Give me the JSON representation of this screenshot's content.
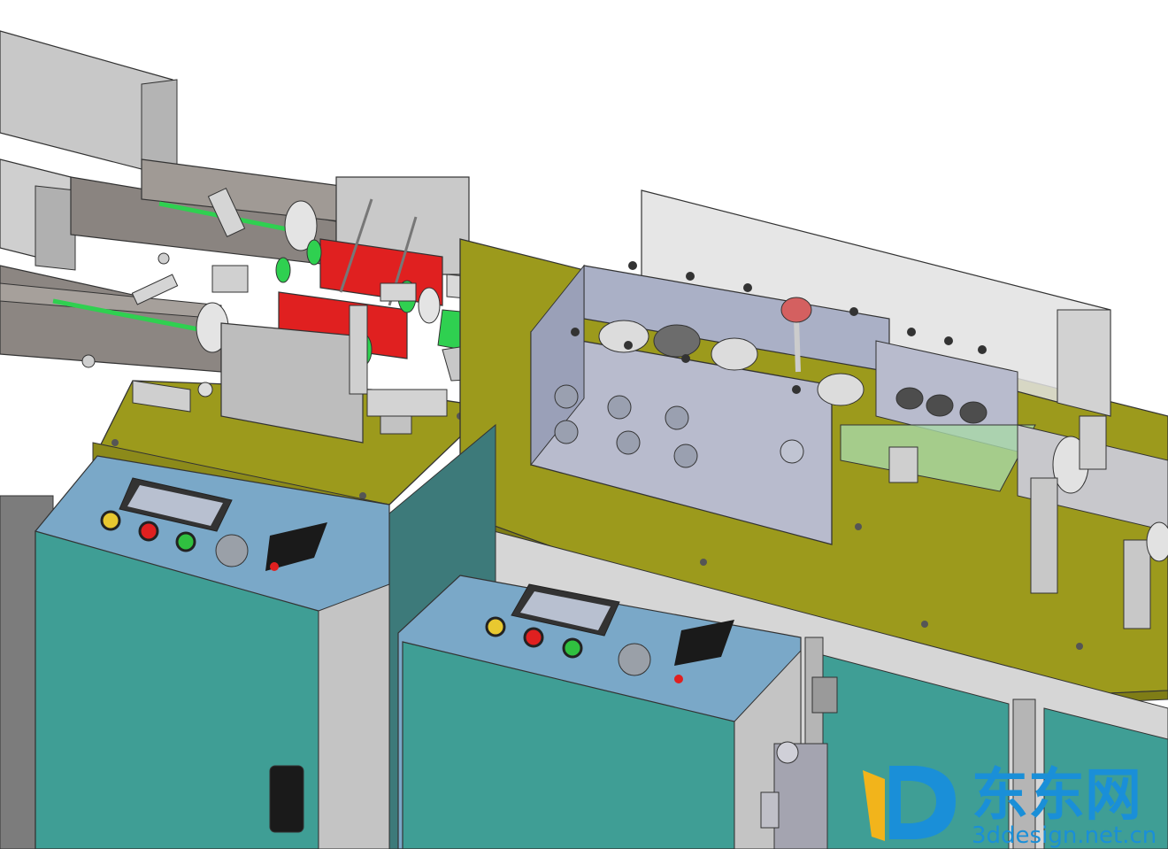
{
  "watermark": {
    "brand_name": "东东网",
    "url": "3ddesign.net.cn",
    "logo_letter": "D"
  },
  "colors": {
    "background": "#ffffff",
    "tabletop": "#9c9a1c",
    "cabinet_door": "#3f9e95",
    "panel_blue": "#7aa8c8",
    "red_part": "#e02020",
    "green_part": "#2fd050",
    "steel": "#b9bcc4",
    "gray_frame": "#a9a9a9",
    "logo_yellow": "#f2b41b",
    "logo_blue": "#1a8fd8"
  }
}
